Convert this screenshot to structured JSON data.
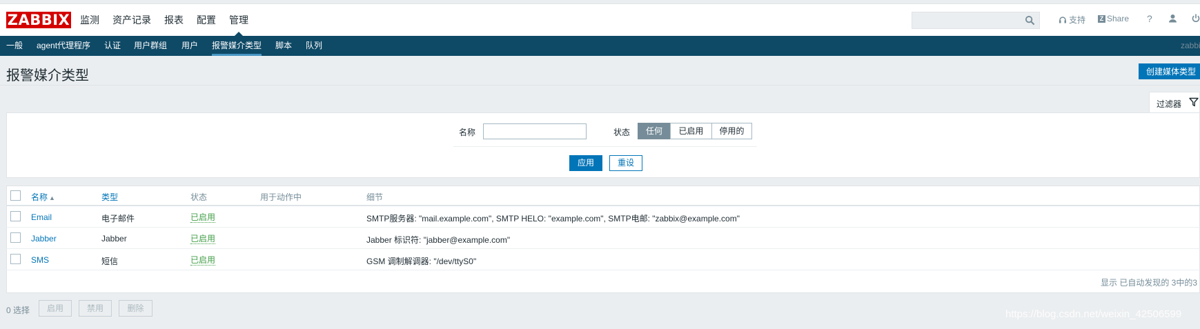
{
  "header": {
    "logo": "ZABBIX",
    "nav": [
      "监测",
      "资产记录",
      "报表",
      "配置",
      "管理"
    ],
    "search_placeholder": "",
    "support_label": "支持",
    "share_badge": "Z",
    "share_label": "Share",
    "help_label": "?"
  },
  "subnav": {
    "items": [
      "一般",
      "agent代理程序",
      "认证",
      "用户群组",
      "用户",
      "报警媒介类型",
      "脚本",
      "队列"
    ],
    "selected": "报警媒介类型",
    "user": "zabbix"
  },
  "page": {
    "title": "报警媒介类型",
    "create_button": "创建媒体类型"
  },
  "filter": {
    "tab_label": "过滤器",
    "name_label": "名称",
    "name_value": "",
    "status_label": "状态",
    "status_options": [
      "任何",
      "已启用",
      "停用的"
    ],
    "status_selected": "任何",
    "apply_label": "应用",
    "reset_label": "重设"
  },
  "table": {
    "columns": [
      "名称",
      "类型",
      "状态",
      "用于动作中",
      "细节"
    ],
    "sort_indicator": "▲",
    "rows": [
      {
        "name": "Email",
        "type": "电子邮件",
        "status": "已启用",
        "used_in_actions": "",
        "details": "SMTP服务器: \"mail.example.com\", SMTP HELO: \"example.com\", SMTP电邮: \"zabbix@example.com\""
      },
      {
        "name": "Jabber",
        "type": "Jabber",
        "status": "已启用",
        "used_in_actions": "",
        "details": "Jabber 标识符: \"jabber@example.com\""
      },
      {
        "name": "SMS",
        "type": "短信",
        "status": "已启用",
        "used_in_actions": "",
        "details": "GSM 调制解调器: \"/dev/ttyS0\""
      }
    ],
    "pager_text": "显示 已自动发现的 3中的3"
  },
  "actions": {
    "selected_count": "0 选择",
    "enable": "启用",
    "disable": "禁用",
    "delete": "删除"
  },
  "watermark": "https://blog.csdn.net/weixin_42506599",
  "colors": {
    "logo_red": "#d40000",
    "subnav_bg": "#0e4966",
    "primary_blue": "#0275b8",
    "enabled_green": "#429e47",
    "page_bg": "#ebeef0"
  }
}
